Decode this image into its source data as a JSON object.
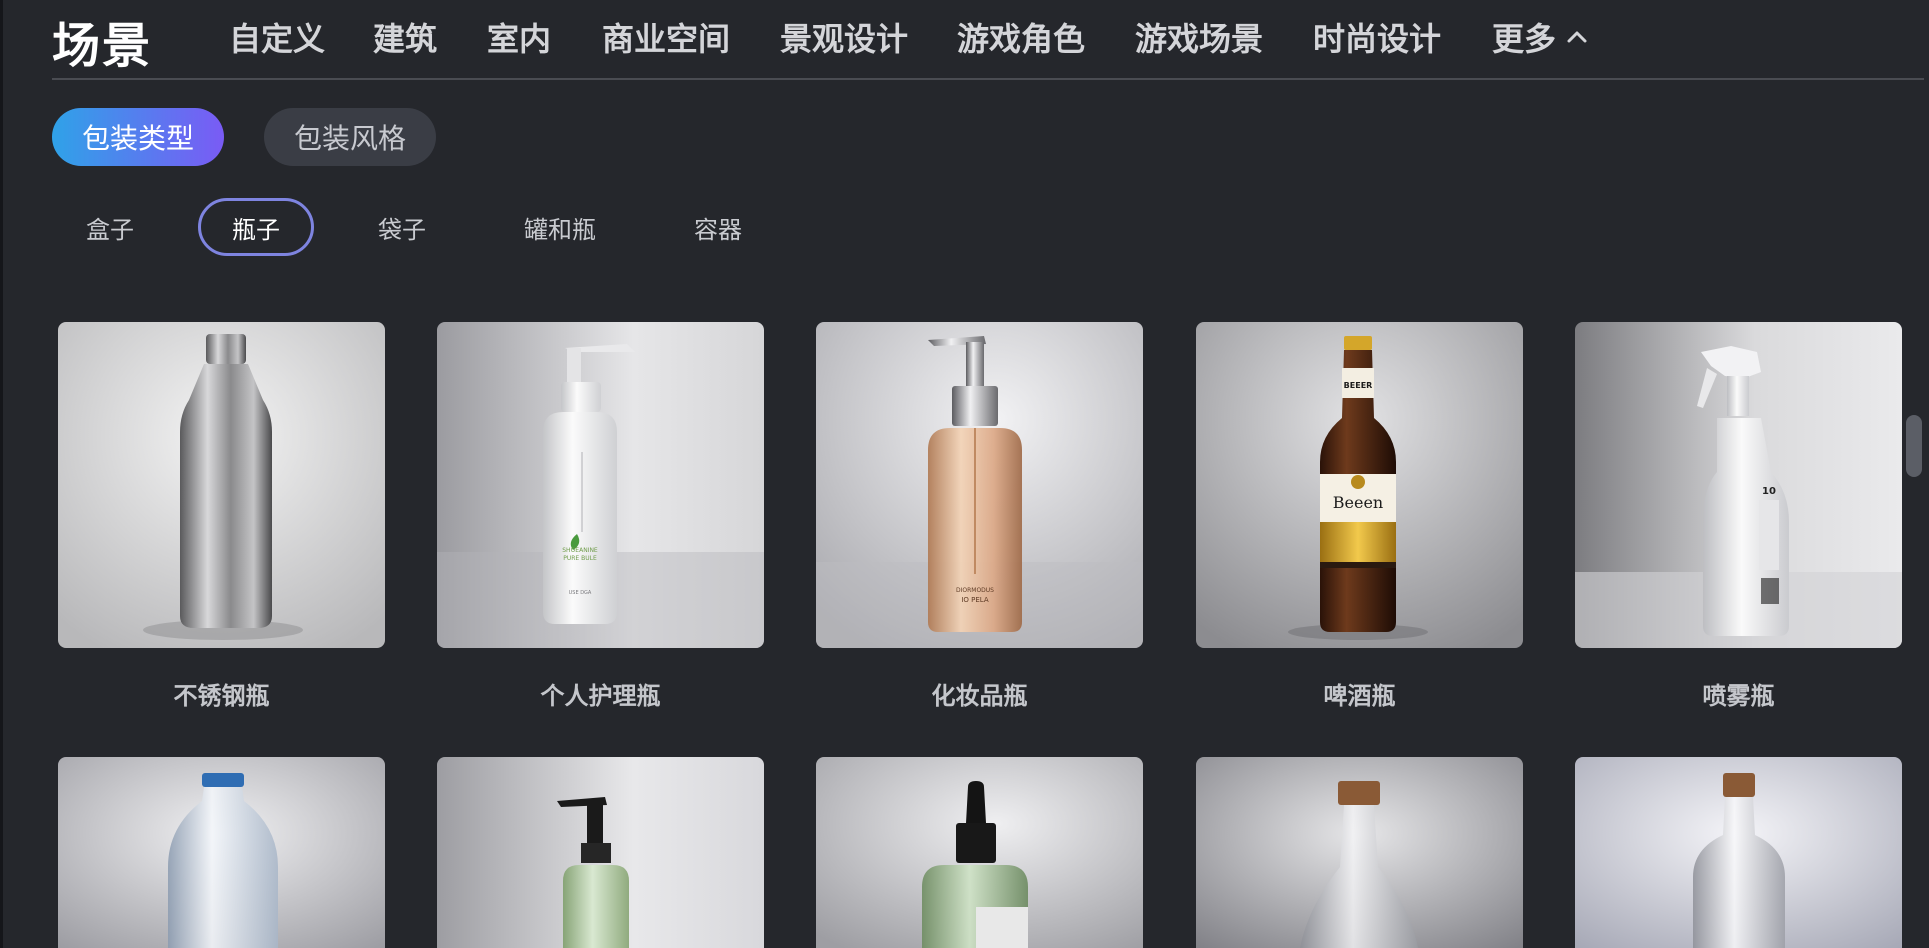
{
  "header": {
    "title": "场景",
    "nav": [
      "自定义",
      "建筑",
      "室内",
      "商业空间",
      "景观设计",
      "游戏角色",
      "游戏场景",
      "时尚设计",
      "更多"
    ]
  },
  "category_tabs": [
    "包装类型",
    "包装风格"
  ],
  "sub_tabs": [
    "盒子",
    "瓶子",
    "袋子",
    "罐和瓶",
    "容器"
  ],
  "selected_sub_tab": "瓶子",
  "cards": [
    {
      "label": "不锈钢瓶",
      "image": "stainless-steel-bottle"
    },
    {
      "label": "个人护理瓶",
      "image": "personal-care-pump-bottle",
      "print": [
        "SHOEANINE",
        "PURE BULE",
        "USE DGA"
      ]
    },
    {
      "label": "化妆品瓶",
      "image": "cosmetic-pump-bottle",
      "print": [
        "DIORMODUS",
        "IO PELA"
      ]
    },
    {
      "label": "啤酒瓶",
      "image": "beer-bottle",
      "print": [
        "BEEER",
        "Beeen"
      ]
    },
    {
      "label": "喷雾瓶",
      "image": "spray-bottle",
      "print": [
        "10"
      ]
    },
    {
      "label": "",
      "image": "plastic-water-bottle"
    },
    {
      "label": "",
      "image": "clear-pump-bottle"
    },
    {
      "label": "",
      "image": "dropper-bottle"
    },
    {
      "label": "",
      "image": "glass-carafe"
    },
    {
      "label": "",
      "image": "glass-bottle-cork"
    }
  ]
}
